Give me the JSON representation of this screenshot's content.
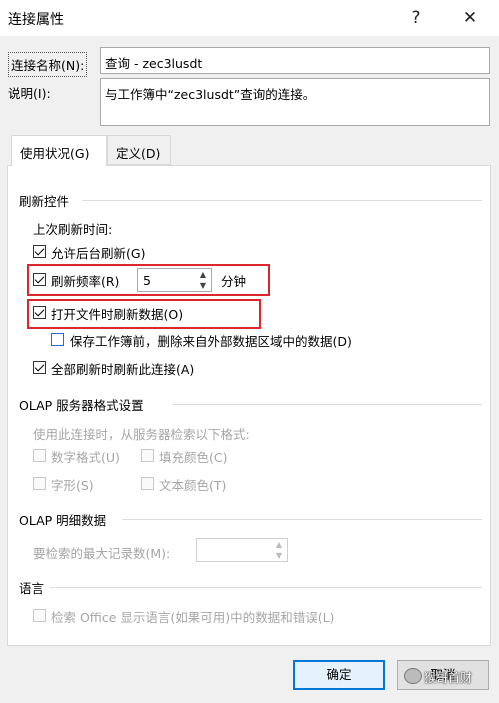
{
  "window": {
    "title": "连接属性",
    "help_btn": "?",
    "close_btn": "✕"
  },
  "connection_name": {
    "label": "连接名称(N):",
    "value": "查询 - zec3lusdt"
  },
  "description": {
    "label": "说明(I):",
    "value": "与工作簿中“zec3lusdt”查询的连接。"
  },
  "tabs": [
    {
      "label": "使用状况(G)"
    },
    {
      "label": "定义(D)"
    }
  ],
  "refresh_group": {
    "title": "刷新控件",
    "last_refresh": "上次刷新时间:",
    "background_refresh": "允许后台刷新(G)",
    "refresh_every": "刷新频率(R)",
    "refresh_minutes": "5",
    "minutes_unit": "分钟",
    "refresh_on_open": "打开文件时刷新数据(O)",
    "remove_data_before_save": "保存工作簿前，删除来自外部数据区域中的数据(D)",
    "refresh_all": "全部刷新时刷新此连接(A)"
  },
  "olap_format": {
    "title": "OLAP 服务器格式设置",
    "desc": "使用此连接时，从服务器检索以下格式:",
    "number_format": "数字格式(U)",
    "fill_color": "填充颜色(C)",
    "font_style": "字形(S)",
    "text_color": "文本颜色(T)"
  },
  "olap_detail": {
    "title": "OLAP 明细数据",
    "max_records_label": "要检索的最大记录数(M):"
  },
  "language": {
    "title": "语言",
    "option": "检索 Office 显示语言(如果可用)中的数据和错误(L)"
  },
  "buttons": {
    "ok": "确定",
    "cancel": "取消"
  },
  "watermark": {
    "text": "猴哥首财"
  },
  "colors": {
    "highlight_red": "#e0262d",
    "accent_blue": "#0078d7"
  }
}
